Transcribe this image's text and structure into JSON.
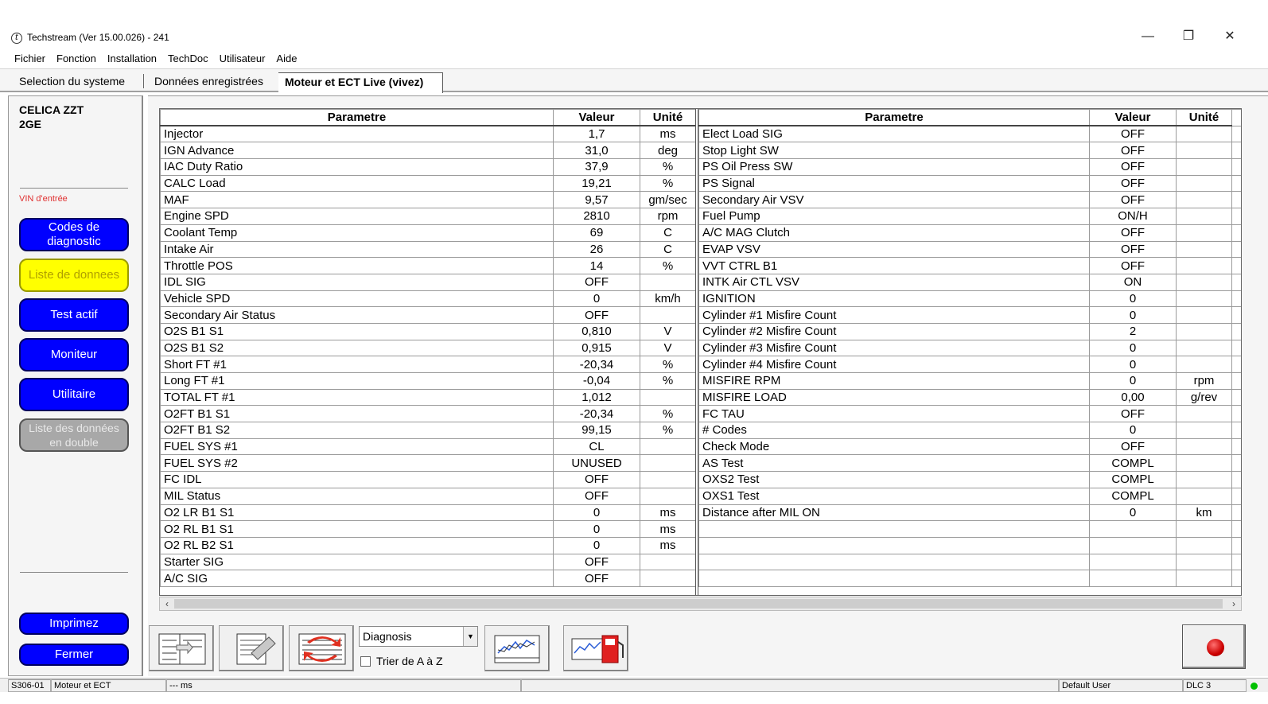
{
  "window": {
    "title": "Techstream (Ver 15.00.026) - 241",
    "app_icon": "techstream-logo-icon",
    "minimize": "—",
    "restore": "❐",
    "close": "✕"
  },
  "menu": [
    "Fichier",
    "Fonction",
    "Installation",
    "TechDoc",
    "Utilisateur",
    "Aide"
  ],
  "tabs": [
    "Selection du systeme",
    "Données enregistrées",
    "Moteur et ECT Live (vivez)"
  ],
  "sidebar": {
    "vehicle_line1": "CELICA ZZT",
    "vehicle_line2": "2GE",
    "vin_label": "VIN d'entrée",
    "buttons": {
      "codes": "Codes de diagnostic",
      "liste": "Liste de donnees",
      "test": "Test actif",
      "moniteur": "Moniteur",
      "utilitaire": "Utilitaire",
      "double_1": "Liste des données",
      "double_2": "en double",
      "imprimez": "Imprimez",
      "fermer": "Fermer"
    }
  },
  "grid": {
    "headers": {
      "param": "Parametre",
      "value": "Valeur",
      "unit": "Unité"
    },
    "left": [
      [
        "Injector",
        "1,7",
        "ms"
      ],
      [
        "IGN Advance",
        "31,0",
        "deg"
      ],
      [
        "IAC Duty Ratio",
        "37,9",
        "%"
      ],
      [
        "CALC Load",
        "19,21",
        "%"
      ],
      [
        "MAF",
        "9,57",
        "gm/sec"
      ],
      [
        "Engine SPD",
        "2810",
        "rpm"
      ],
      [
        "Coolant Temp",
        "69",
        "C"
      ],
      [
        "Intake Air",
        "26",
        "C"
      ],
      [
        "Throttle POS",
        "14",
        "%"
      ],
      [
        "IDL SIG",
        "OFF",
        ""
      ],
      [
        "Vehicle SPD",
        "0",
        "km/h"
      ],
      [
        "Secondary Air Status",
        "OFF",
        ""
      ],
      [
        "O2S B1 S1",
        "0,810",
        "V"
      ],
      [
        "O2S B1 S2",
        "0,915",
        "V"
      ],
      [
        "Short FT #1",
        "-20,34",
        "%"
      ],
      [
        "Long FT #1",
        "-0,04",
        "%"
      ],
      [
        "TOTAL FT #1",
        "1,012",
        ""
      ],
      [
        "O2FT B1 S1",
        "-20,34",
        "%"
      ],
      [
        "O2FT B1 S2",
        "99,15",
        "%"
      ],
      [
        "FUEL SYS #1",
        "CL",
        ""
      ],
      [
        "FUEL SYS #2",
        "UNUSED",
        ""
      ],
      [
        "FC IDL",
        "OFF",
        ""
      ],
      [
        "MIL Status",
        "OFF",
        ""
      ],
      [
        "O2 LR B1 S1",
        "0",
        "ms"
      ],
      [
        "O2 RL B1 S1",
        "0",
        "ms"
      ],
      [
        "O2 RL B2 S1",
        "0",
        "ms"
      ],
      [
        "Starter SIG",
        "OFF",
        ""
      ],
      [
        "A/C SIG",
        "OFF",
        ""
      ]
    ],
    "right": [
      [
        "Elect Load SIG",
        "OFF",
        ""
      ],
      [
        "Stop Light SW",
        "OFF",
        ""
      ],
      [
        "PS Oil Press SW",
        "OFF",
        ""
      ],
      [
        "PS Signal",
        "OFF",
        ""
      ],
      [
        "Secondary Air VSV",
        "OFF",
        ""
      ],
      [
        "Fuel Pump",
        "ON/H",
        ""
      ],
      [
        "A/C MAG Clutch",
        "OFF",
        ""
      ],
      [
        "EVAP VSV",
        "OFF",
        ""
      ],
      [
        "VVT CTRL B1",
        "OFF",
        ""
      ],
      [
        "INTK Air CTL VSV",
        "ON",
        ""
      ],
      [
        "IGNITION",
        "0",
        ""
      ],
      [
        "Cylinder #1 Misfire Count",
        "0",
        ""
      ],
      [
        "Cylinder #2 Misfire Count",
        "2",
        ""
      ],
      [
        "Cylinder #3 Misfire Count",
        "0",
        ""
      ],
      [
        "Cylinder #4 Misfire Count",
        "0",
        ""
      ],
      [
        "MISFIRE RPM",
        "0",
        "rpm"
      ],
      [
        "MISFIRE LOAD",
        "0,00",
        "g/rev"
      ],
      [
        "FC TAU",
        "OFF",
        ""
      ],
      [
        "# Codes",
        "0",
        ""
      ],
      [
        "Check Mode",
        "OFF",
        ""
      ],
      [
        "AS Test",
        "COMPL",
        ""
      ],
      [
        "OXS2 Test",
        "COMPL",
        ""
      ],
      [
        "OXS1 Test",
        "COMPL",
        ""
      ],
      [
        "Distance after MIL ON",
        "0",
        "km"
      ],
      [
        "",
        "",
        ""
      ],
      [
        "",
        "",
        ""
      ],
      [
        "",
        "",
        ""
      ],
      [
        "",
        "",
        ""
      ]
    ]
  },
  "toolbar": {
    "select_value": "Diagnosis",
    "sort_label": "Trier de A à Z",
    "icons": [
      "table-layout-icon",
      "snapshot-icon",
      "swap-list-icon",
      "graph-icon",
      "graph-fuel-icon",
      "record-icon"
    ]
  },
  "statusbar": {
    "code": "S306-01",
    "system": "Moteur et ECT",
    "timing": "--- ms",
    "user": "Default User",
    "dlc": "DLC 3"
  },
  "colors": {
    "button_blue": "#0000ff",
    "button_yellow": "#ffff00",
    "button_gray": "#a8a8a8",
    "vin_red": "#e03030",
    "status_green": "#00c000",
    "record_red": "#cc0000"
  }
}
